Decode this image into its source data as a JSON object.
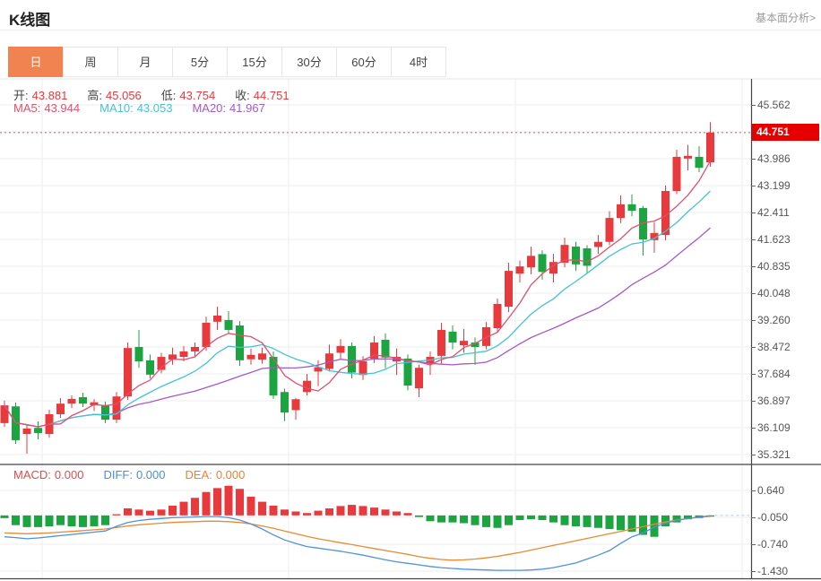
{
  "header": {
    "title": "K线图",
    "analysis_link": "基本面分析>"
  },
  "tabs": {
    "items": [
      "日",
      "周",
      "月",
      "5分",
      "15分",
      "30分",
      "60分",
      "4时"
    ],
    "active_index": 0
  },
  "legend": {
    "ohlc": [
      {
        "label": "开:",
        "value": "43.881"
      },
      {
        "label": "高:",
        "value": "45.056"
      },
      {
        "label": "低:",
        "value": "43.754"
      },
      {
        "label": "收:",
        "value": "44.751"
      }
    ],
    "ma": [
      {
        "label": "MA5:",
        "value": "43.944",
        "color": "#e0506e"
      },
      {
        "label": "MA10:",
        "value": "43.053",
        "color": "#46c2d5"
      },
      {
        "label": "MA20:",
        "value": "41.967",
        "color": "#a55ac5"
      }
    ],
    "macd": [
      {
        "label": "MACD:",
        "value": "0.000",
        "color": "#e14c4c"
      },
      {
        "label": "DIFF:",
        "value": "0.000",
        "color": "#4a8fdd"
      },
      {
        "label": "DEA:",
        "value": "0.000",
        "color": "#e8842c"
      }
    ]
  },
  "price_axis": {
    "ticks": [
      45.562,
      43.986,
      43.199,
      42.411,
      41.623,
      40.835,
      40.048,
      39.26,
      38.472,
      37.684,
      36.897,
      36.109,
      35.321
    ],
    "current_label": "44.751"
  },
  "macd_axis": {
    "ticks": [
      0.64,
      -0.05,
      -0.74,
      -1.43
    ]
  },
  "colors": {
    "up": "#e8393d",
    "down": "#1ba43f",
    "ma5": "#e0506e",
    "ma10": "#46c2d5",
    "ma20": "#a55ac5",
    "diff": "#4f93d8",
    "dea": "#e78a33",
    "accent": "#f0834f",
    "price_tag_bg": "#e60000",
    "price_line": "#e06060",
    "grid": "#ededed",
    "axis": "#444444",
    "macd_dashed": "#a9cdec"
  },
  "chart_data": {
    "type": "candlestick_with_macd",
    "title": "K线图",
    "panels": [
      "price",
      "macd"
    ],
    "price_ticks": [
      45.562,
      43.986,
      43.199,
      42.411,
      41.623,
      40.835,
      40.048,
      39.26,
      38.472,
      37.684,
      36.897,
      36.109,
      35.321
    ],
    "tick_step": 0.788,
    "current_price": 44.751,
    "last_ohlc": {
      "open": 43.881,
      "high": 45.056,
      "low": 43.754,
      "close": 44.751
    },
    "ma_periods": [
      5,
      10,
      20
    ],
    "ma_last_values": {
      "MA5": 43.944,
      "MA10": 43.053,
      "MA20": 41.967
    },
    "candles_ohlc": [
      [
        36.24,
        36.9,
        36.13,
        36.76
      ],
      [
        36.73,
        36.84,
        35.63,
        35.74
      ],
      [
        35.92,
        36.18,
        35.34,
        36.08
      ],
      [
        36.1,
        36.29,
        35.76,
        35.95
      ],
      [
        35.92,
        36.63,
        35.81,
        36.5
      ],
      [
        36.5,
        36.97,
        36.39,
        36.81
      ],
      [
        36.81,
        37.05,
        36.68,
        36.95
      ],
      [
        37.0,
        37.13,
        36.71,
        36.81
      ],
      [
        36.76,
        36.94,
        36.6,
        36.85
      ],
      [
        36.76,
        36.87,
        36.24,
        36.34
      ],
      [
        36.34,
        37.15,
        36.24,
        37.02
      ],
      [
        37.02,
        38.6,
        36.92,
        38.44
      ],
      [
        38.47,
        38.97,
        37.86,
        38.05
      ],
      [
        38.08,
        38.25,
        37.55,
        37.66
      ],
      [
        37.8,
        38.3,
        37.7,
        38.18
      ],
      [
        38.1,
        38.45,
        37.95,
        38.25
      ],
      [
        38.18,
        38.5,
        38.05,
        38.34
      ],
      [
        38.34,
        38.6,
        38.2,
        38.47
      ],
      [
        38.47,
        39.36,
        38.36,
        39.18
      ],
      [
        39.21,
        39.65,
        38.97,
        39.39
      ],
      [
        39.26,
        39.52,
        38.86,
        38.97
      ],
      [
        39.1,
        39.23,
        37.92,
        38.08
      ],
      [
        38.11,
        38.42,
        37.95,
        38.24
      ],
      [
        38.1,
        38.45,
        37.98,
        38.28
      ],
      [
        38.18,
        38.34,
        36.95,
        37.05
      ],
      [
        37.15,
        37.25,
        36.3,
        36.55
      ],
      [
        36.62,
        36.98,
        36.34,
        36.94
      ],
      [
        37.15,
        37.68,
        37.05,
        37.48
      ],
      [
        37.75,
        38.08,
        37.32,
        37.88
      ],
      [
        37.83,
        38.54,
        37.75,
        38.28
      ],
      [
        38.3,
        38.7,
        38.1,
        38.5
      ],
      [
        38.5,
        38.6,
        37.55,
        37.72
      ],
      [
        37.65,
        38.2,
        37.5,
        38.05
      ],
      [
        38.13,
        38.79,
        38.0,
        38.6
      ],
      [
        38.68,
        38.87,
        37.85,
        38.16
      ],
      [
        38.05,
        38.43,
        37.65,
        38.18
      ],
      [
        38.13,
        38.25,
        37.2,
        37.34
      ],
      [
        37.26,
        37.95,
        37.0,
        37.86
      ],
      [
        37.99,
        38.34,
        37.65,
        38.18
      ],
      [
        38.21,
        39.18,
        37.99,
        38.97
      ],
      [
        38.92,
        39.1,
        38.4,
        38.6
      ],
      [
        38.52,
        39.0,
        38.3,
        38.65
      ],
      [
        38.6,
        38.75,
        37.95,
        38.47
      ],
      [
        38.5,
        39.2,
        38.4,
        39.05
      ],
      [
        39.02,
        39.89,
        38.9,
        39.73
      ],
      [
        39.65,
        40.94,
        39.49,
        40.7
      ],
      [
        40.62,
        41.0,
        40.36,
        40.83
      ],
      [
        40.8,
        41.41,
        40.6,
        41.14
      ],
      [
        41.19,
        41.3,
        40.44,
        40.67
      ],
      [
        40.62,
        41.2,
        40.36,
        40.96
      ],
      [
        40.94,
        41.67,
        40.8,
        41.46
      ],
      [
        41.41,
        41.55,
        40.7,
        40.89
      ],
      [
        41.36,
        41.45,
        40.62,
        40.85
      ],
      [
        41.4,
        41.75,
        41.2,
        41.55
      ],
      [
        41.55,
        42.45,
        41.45,
        42.25
      ],
      [
        42.25,
        42.91,
        42.1,
        42.65
      ],
      [
        42.65,
        42.94,
        42.3,
        42.46
      ],
      [
        42.54,
        42.6,
        41.15,
        41.62
      ],
      [
        41.6,
        42.12,
        41.23,
        41.81
      ],
      [
        41.75,
        43.2,
        41.6,
        43.04
      ],
      [
        43.04,
        44.25,
        42.95,
        44.04
      ],
      [
        43.99,
        44.39,
        43.64,
        44.07
      ],
      [
        44.04,
        44.35,
        43.59,
        43.72
      ],
      [
        43.881,
        45.056,
        43.754,
        44.751
      ]
    ],
    "macd": {
      "ticks": [
        0.64,
        -0.05,
        -0.74,
        -1.43
      ],
      "last_values": {
        "MACD": 0.0,
        "DIFF": 0.0,
        "DEA": 0.0
      },
      "histogram": [
        -0.07,
        -0.25,
        -0.3,
        -0.3,
        -0.28,
        -0.25,
        -0.28,
        -0.3,
        -0.28,
        -0.25,
        0.03,
        0.18,
        0.15,
        0.12,
        0.15,
        0.25,
        0.35,
        0.45,
        0.6,
        0.7,
        0.76,
        0.68,
        0.48,
        0.35,
        0.25,
        0.15,
        0.1,
        0.06,
        0.12,
        0.18,
        0.24,
        0.27,
        0.24,
        0.2,
        0.15,
        0.1,
        0.06,
        -0.04,
        -0.15,
        -0.18,
        -0.18,
        -0.2,
        -0.25,
        -0.3,
        -0.32,
        -0.25,
        -0.12,
        -0.1,
        -0.12,
        -0.18,
        -0.25,
        -0.28,
        -0.3,
        -0.32,
        -0.35,
        -0.38,
        -0.42,
        -0.5,
        -0.55,
        -0.28,
        -0.18,
        -0.1,
        -0.07,
        -0.03
      ],
      "diff_line": [
        -0.55,
        -0.57,
        -0.6,
        -0.58,
        -0.55,
        -0.52,
        -0.49,
        -0.46,
        -0.43,
        -0.4,
        -0.28,
        -0.18,
        -0.13,
        -0.1,
        -0.08,
        -0.06,
        -0.05,
        -0.04,
        -0.03,
        -0.03,
        -0.06,
        -0.12,
        -0.22,
        -0.35,
        -0.5,
        -0.63,
        -0.72,
        -0.8,
        -0.84,
        -0.88,
        -0.92,
        -0.97,
        -1.02,
        -1.08,
        -1.14,
        -1.19,
        -1.23,
        -1.27,
        -1.31,
        -1.34,
        -1.36,
        -1.38,
        -1.39,
        -1.4,
        -1.41,
        -1.41,
        -1.41,
        -1.4,
        -1.38,
        -1.34,
        -1.28,
        -1.22,
        -1.12,
        -1.02,
        -0.9,
        -0.72,
        -0.55,
        -0.45,
        -0.3,
        -0.2,
        -0.13,
        -0.08,
        -0.04,
        -0.01
      ],
      "dea_line": [
        -0.45,
        -0.46,
        -0.47,
        -0.46,
        -0.45,
        -0.43,
        -0.41,
        -0.39,
        -0.37,
        -0.35,
        -0.31,
        -0.27,
        -0.24,
        -0.22,
        -0.2,
        -0.18,
        -0.17,
        -0.16,
        -0.15,
        -0.15,
        -0.16,
        -0.18,
        -0.22,
        -0.27,
        -0.33,
        -0.4,
        -0.47,
        -0.54,
        -0.6,
        -0.65,
        -0.7,
        -0.75,
        -0.8,
        -0.85,
        -0.9,
        -0.95,
        -1.0,
        -1.06,
        -1.1,
        -1.13,
        -1.15,
        -1.14,
        -1.12,
        -1.09,
        -1.05,
        -1.0,
        -0.95,
        -0.89,
        -0.83,
        -0.77,
        -0.71,
        -0.65,
        -0.59,
        -0.53,
        -0.47,
        -0.41,
        -0.35,
        -0.29,
        -0.23,
        -0.17,
        -0.12,
        -0.08,
        -0.05,
        -0.02
      ]
    }
  }
}
